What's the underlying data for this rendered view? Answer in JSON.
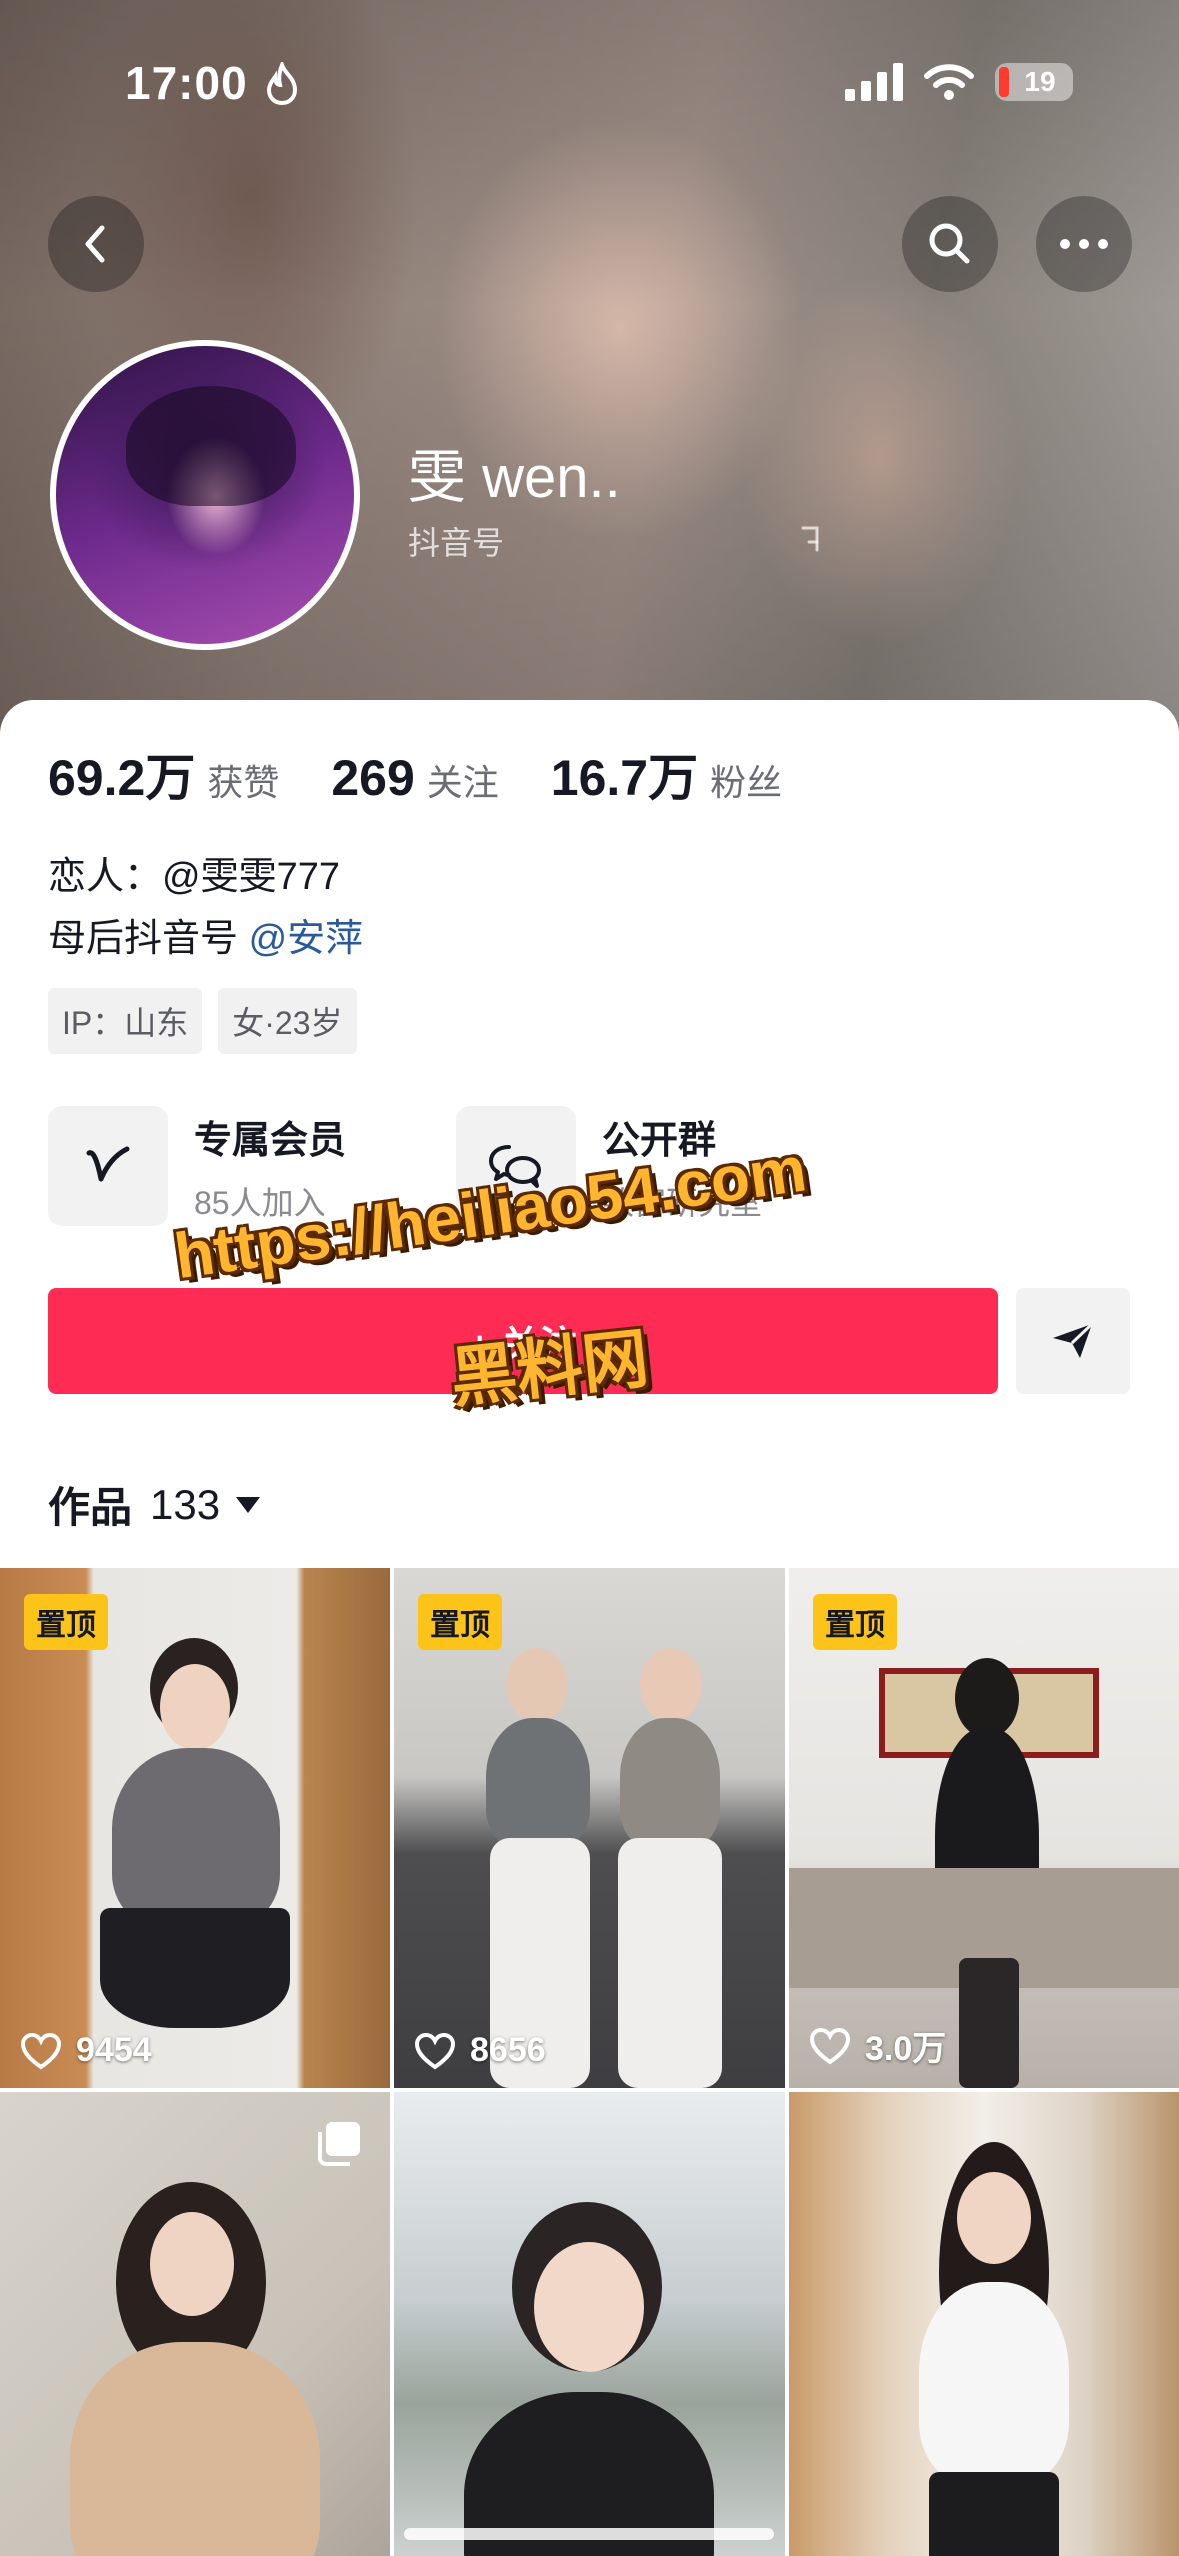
{
  "status_bar": {
    "time": "17:00",
    "battery": "19"
  },
  "profile": {
    "name": "雯 wen..",
    "douyin_id_label": "抖音号",
    "stats": [
      {
        "value": "69.2万",
        "label": "获赞"
      },
      {
        "value": "269",
        "label": "关注"
      },
      {
        "value": "16.7万",
        "label": "粉丝"
      }
    ],
    "bio_line1": "恋人：@雯雯777",
    "bio_line2_prefix": "母后抖音号",
    "bio_line2_mention": "@安萍",
    "tags": [
      "IP：山东",
      "女·23岁"
    ]
  },
  "features": [
    {
      "title": "专属会员",
      "subtitle": "85人加入"
    },
    {
      "title": "公开群",
      "subtitle": "致富研究室"
    }
  ],
  "follow_button": "+ 关注",
  "watermark": {
    "line1": "https://heiliao54.com",
    "line2": "黑料网"
  },
  "works": {
    "label": "作品",
    "count": "133"
  },
  "videos": [
    {
      "pinned": "置顶",
      "likes": "9454"
    },
    {
      "pinned": "置顶",
      "likes": "8656"
    },
    {
      "pinned": "置顶",
      "likes": "3.0万"
    },
    {
      "pinned": "",
      "likes": ""
    },
    {
      "pinned": "",
      "likes": ""
    },
    {
      "pinned": "",
      "likes": ""
    }
  ],
  "colors": {
    "accent": "#fe2c55",
    "mention": "#2a5a9b",
    "pin": "#fcc418"
  },
  "icons": [
    "back-icon",
    "search-icon",
    "more-icon",
    "copy-icon",
    "vip-icon",
    "group-chat-icon",
    "share-icon",
    "heart-icon",
    "multi-photo-icon"
  ]
}
